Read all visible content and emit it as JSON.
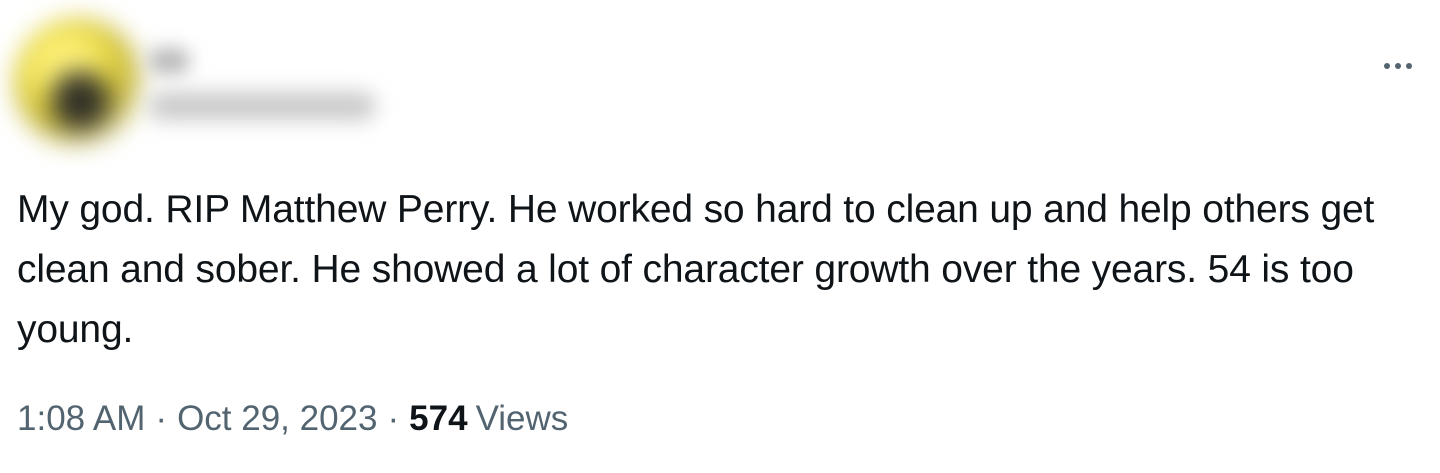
{
  "tweet": {
    "author": {
      "avatar_icon": "blurred-avatar-icon"
    },
    "more_icon": "more-horizontal-icon",
    "text": "My god. RIP Matthew Perry. He worked so hard to clean up and help others get clean and sober. He showed a lot of character growth over the years. 54 is too young.",
    "time": "1:08 AM",
    "separator": "·",
    "date": "Oct 29, 2023",
    "views_count": "574",
    "views_label": "Views"
  },
  "colors": {
    "text": "#0f1419",
    "secondary": "#536471",
    "background": "#ffffff"
  }
}
